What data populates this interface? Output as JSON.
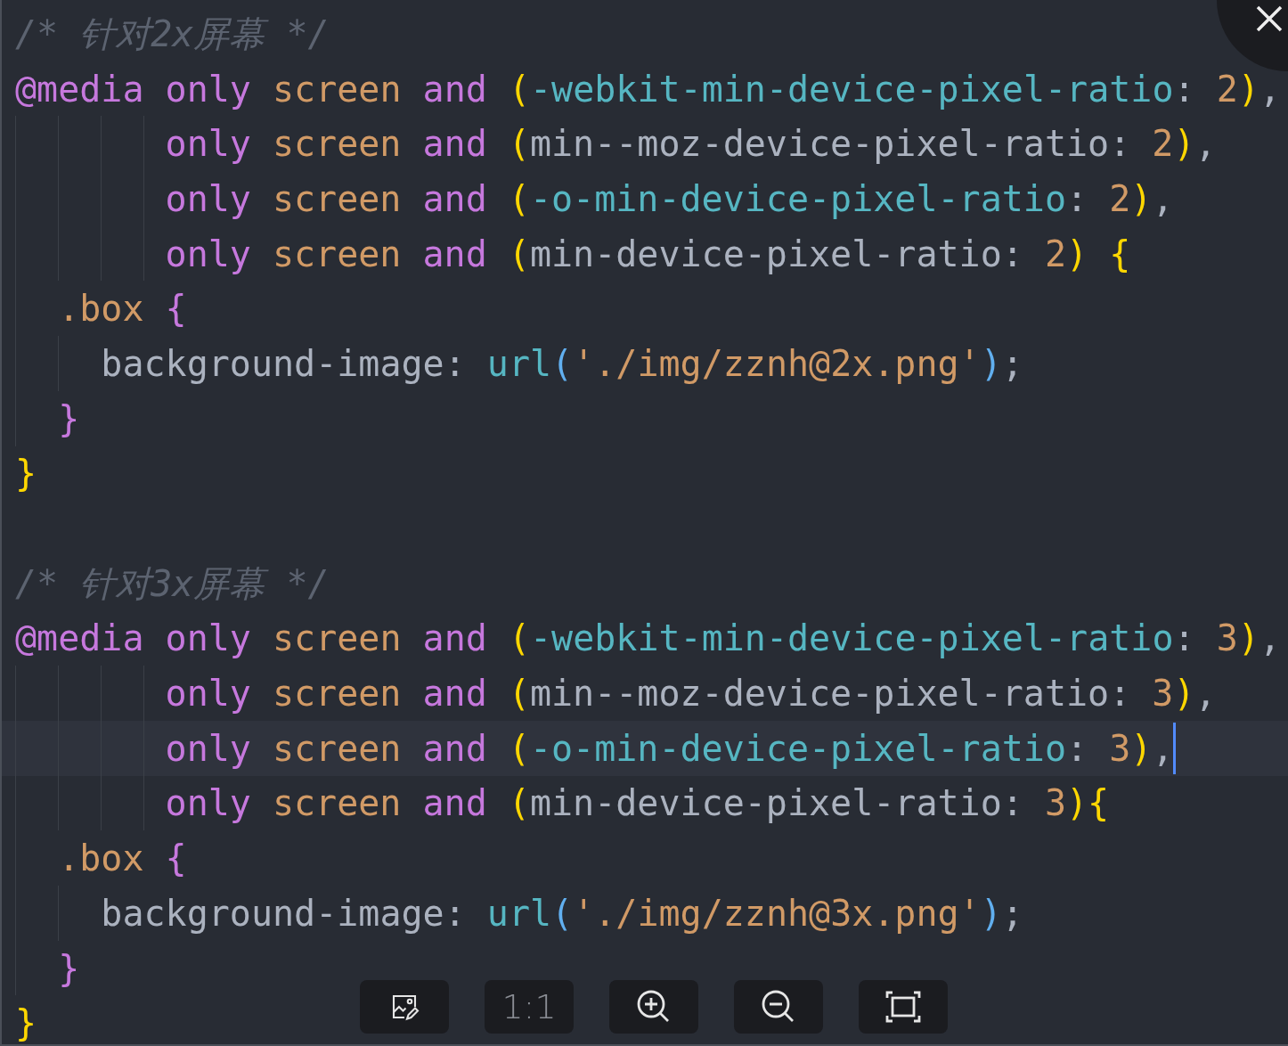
{
  "editor": {
    "lines": [
      {
        "kind": "top",
        "tokens": [
          {
            "kind": "comment",
            "text": "/* 针对2x屏幕 */"
          }
        ]
      },
      {
        "kind": "top",
        "tokens": [
          {
            "kind": "atrule",
            "text": "@media"
          },
          {
            "kind": "keyword",
            "text": " only"
          },
          {
            "kind": "media",
            "text": " screen"
          },
          {
            "kind": "keyword",
            "text": " and"
          },
          {
            "kind": "paren",
            "text": " ("
          },
          {
            "kind": "prefixed",
            "text": "-webkit-min-device-pixel-ratio"
          },
          {
            "kind": "plain",
            "text": ": "
          },
          {
            "kind": "number",
            "text": "2"
          },
          {
            "kind": "paren",
            "text": ")"
          },
          {
            "kind": "plain",
            "text": ","
          }
        ]
      },
      {
        "kind": "continuation",
        "tokens": [
          {
            "kind": "keyword",
            "text": "only"
          },
          {
            "kind": "media",
            "text": " screen"
          },
          {
            "kind": "keyword",
            "text": " and"
          },
          {
            "kind": "paren",
            "text": " ("
          },
          {
            "kind": "plain",
            "text": "min--moz-device-pixel-ratio: "
          },
          {
            "kind": "number",
            "text": "2"
          },
          {
            "kind": "paren",
            "text": ")"
          },
          {
            "kind": "plain",
            "text": ","
          }
        ]
      },
      {
        "kind": "continuation",
        "tokens": [
          {
            "kind": "keyword",
            "text": "only"
          },
          {
            "kind": "media",
            "text": " screen"
          },
          {
            "kind": "keyword",
            "text": " and"
          },
          {
            "kind": "paren",
            "text": " ("
          },
          {
            "kind": "prefixed",
            "text": "-o-min-device-pixel-ratio"
          },
          {
            "kind": "plain",
            "text": ": "
          },
          {
            "kind": "number",
            "text": "2"
          },
          {
            "kind": "paren",
            "text": ")"
          },
          {
            "kind": "plain",
            "text": ","
          }
        ]
      },
      {
        "kind": "continuation",
        "tokens": [
          {
            "kind": "keyword",
            "text": "only"
          },
          {
            "kind": "media",
            "text": " screen"
          },
          {
            "kind": "keyword",
            "text": " and"
          },
          {
            "kind": "paren",
            "text": " ("
          },
          {
            "kind": "plain",
            "text": "min-device-pixel-ratio: "
          },
          {
            "kind": "number",
            "text": "2"
          },
          {
            "kind": "paren",
            "text": ")"
          },
          {
            "kind": "paren",
            "text": " {"
          }
        ]
      },
      {
        "kind": "rule",
        "tokens": [
          {
            "kind": "selector",
            "text": ".box"
          },
          {
            "kind": "brace",
            "text": " {"
          }
        ]
      },
      {
        "kind": "declaration",
        "tokens": [
          {
            "kind": "plain",
            "text": "background-image: "
          },
          {
            "kind": "function",
            "text": "url"
          },
          {
            "kind": "call",
            "text": "("
          },
          {
            "kind": "string",
            "text": "'./img/zznh@2x.png'"
          },
          {
            "kind": "call",
            "text": ")"
          },
          {
            "kind": "plain",
            "text": ";"
          }
        ]
      },
      {
        "kind": "rule",
        "tokens": [
          {
            "kind": "brace",
            "text": "}"
          }
        ]
      },
      {
        "kind": "top",
        "tokens": [
          {
            "kind": "paren",
            "text": "}"
          }
        ]
      },
      {
        "kind": "blank"
      },
      {
        "kind": "top",
        "tokens": [
          {
            "kind": "comment",
            "text": "/* 针对3x屏幕 */"
          }
        ]
      },
      {
        "kind": "top",
        "tokens": [
          {
            "kind": "atrule",
            "text": "@media"
          },
          {
            "kind": "keyword",
            "text": " only"
          },
          {
            "kind": "media",
            "text": " screen"
          },
          {
            "kind": "keyword",
            "text": " and"
          },
          {
            "kind": "paren",
            "text": " ("
          },
          {
            "kind": "prefixed",
            "text": "-webkit-min-device-pixel-ratio"
          },
          {
            "kind": "plain",
            "text": ": "
          },
          {
            "kind": "number",
            "text": "3"
          },
          {
            "kind": "paren",
            "text": ")"
          },
          {
            "kind": "plain",
            "text": ","
          }
        ]
      },
      {
        "kind": "continuation",
        "tokens": [
          {
            "kind": "keyword",
            "text": "only"
          },
          {
            "kind": "media",
            "text": " screen"
          },
          {
            "kind": "keyword",
            "text": " and"
          },
          {
            "kind": "paren",
            "text": " ("
          },
          {
            "kind": "plain",
            "text": "min--moz-device-pixel-ratio: "
          },
          {
            "kind": "number",
            "text": "3"
          },
          {
            "kind": "paren",
            "text": ")"
          },
          {
            "kind": "plain",
            "text": ","
          }
        ]
      },
      {
        "kind": "continuation",
        "current": true,
        "tokens": [
          {
            "kind": "keyword",
            "text": "only"
          },
          {
            "kind": "media",
            "text": " screen"
          },
          {
            "kind": "keyword",
            "text": " and"
          },
          {
            "kind": "paren",
            "text": " ("
          },
          {
            "kind": "prefixed",
            "text": "-o-min-device-pixel-ratio"
          },
          {
            "kind": "plain",
            "text": ": "
          },
          {
            "kind": "number",
            "text": "3"
          },
          {
            "kind": "paren",
            "text": ")"
          },
          {
            "kind": "plain",
            "text": ","
          }
        ]
      },
      {
        "kind": "continuation",
        "tokens": [
          {
            "kind": "keyword",
            "text": "only"
          },
          {
            "kind": "media",
            "text": " screen"
          },
          {
            "kind": "keyword",
            "text": " and"
          },
          {
            "kind": "paren",
            "text": " ("
          },
          {
            "kind": "plain",
            "text": "min-device-pixel-ratio: "
          },
          {
            "kind": "number",
            "text": "3"
          },
          {
            "kind": "paren",
            "text": ")"
          },
          {
            "kind": "paren",
            "text": "{"
          }
        ]
      },
      {
        "kind": "rule",
        "tokens": [
          {
            "kind": "selector",
            "text": ".box"
          },
          {
            "kind": "brace",
            "text": " {"
          }
        ]
      },
      {
        "kind": "declaration",
        "tokens": [
          {
            "kind": "plain",
            "text": "background-image: "
          },
          {
            "kind": "function",
            "text": "url"
          },
          {
            "kind": "call",
            "text": "("
          },
          {
            "kind": "string",
            "text": "'./img/zznh@3x.png'"
          },
          {
            "kind": "call",
            "text": ")"
          },
          {
            "kind": "plain",
            "text": ";"
          }
        ]
      },
      {
        "kind": "rule",
        "tokens": [
          {
            "kind": "brace",
            "text": "}"
          }
        ]
      },
      {
        "kind": "top",
        "tokens": [
          {
            "kind": "paren",
            "text": "}"
          }
        ]
      }
    ]
  },
  "toolbar": [
    {
      "kind": "edit-image",
      "disabled": false
    },
    {
      "kind": "actual-size",
      "label": "1:1",
      "disabled": true
    },
    {
      "kind": "zoom-in",
      "disabled": false
    },
    {
      "kind": "zoom-out",
      "disabled": false
    },
    {
      "kind": "fit",
      "disabled": false
    }
  ]
}
